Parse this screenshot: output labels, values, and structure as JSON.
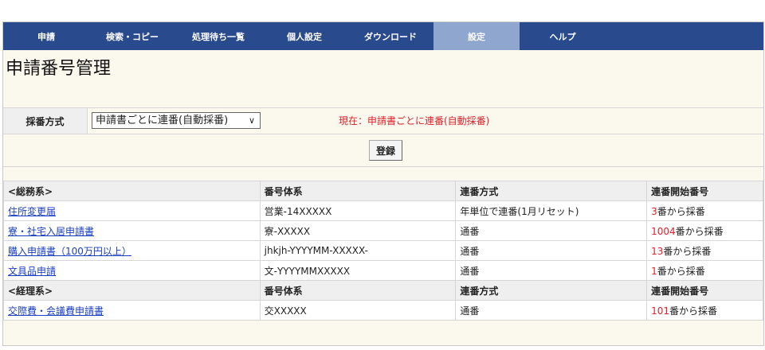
{
  "nav": {
    "items": [
      {
        "label": "申請"
      },
      {
        "label": "検索・コピー"
      },
      {
        "label": "処理待ち一覧"
      },
      {
        "label": "個人設定"
      },
      {
        "label": "ダウンロード"
      },
      {
        "label": "設定",
        "active": true
      },
      {
        "label": "ヘルプ"
      }
    ]
  },
  "page": {
    "title": "申請番号管理"
  },
  "form": {
    "label": "採番方式",
    "select_value": "申請書ごとに連番(自動採番)",
    "current_status": "現在：申請書ごとに連番(自動採番)",
    "register_button": "登録"
  },
  "table": {
    "groups": [
      {
        "name": "<総務系>",
        "headers": [
          "番号体系",
          "連番方式",
          "連番開始番号"
        ],
        "rows": [
          {
            "name": "住所変更届",
            "scheme": "営業-14XXXXX",
            "method": "年単位で連番(1月リセット)",
            "start_num": "3",
            "start_suffix": "番から採番"
          },
          {
            "name": "寮・社宅入居申請書",
            "scheme": "寮-XXXXX",
            "method": "通番",
            "start_num": "1004",
            "start_suffix": "番から採番"
          },
          {
            "name": "購入申請書（100万円以上）",
            "scheme": "jhkjh-YYYYMM-XXXXX-",
            "method": "通番",
            "start_num": "13",
            "start_suffix": "番から採番"
          },
          {
            "name": "文具品申請",
            "scheme": "文-YYYYMMXXXXX",
            "method": "通番",
            "start_num": "1",
            "start_suffix": "番から採番"
          }
        ]
      },
      {
        "name": "<経理系>",
        "headers": [
          "番号体系",
          "連番方式",
          "連番開始番号"
        ],
        "rows": [
          {
            "name": "交際費・会議費申請書",
            "scheme": "交XXXXX",
            "method": "通番",
            "start_num": "101",
            "start_suffix": "番から採番"
          }
        ]
      }
    ]
  },
  "colors": {
    "nav_bg": "#2a4a8e",
    "nav_active": "#8fa6cf",
    "accent_red": "#e0202a",
    "link": "#1a3ec2"
  }
}
